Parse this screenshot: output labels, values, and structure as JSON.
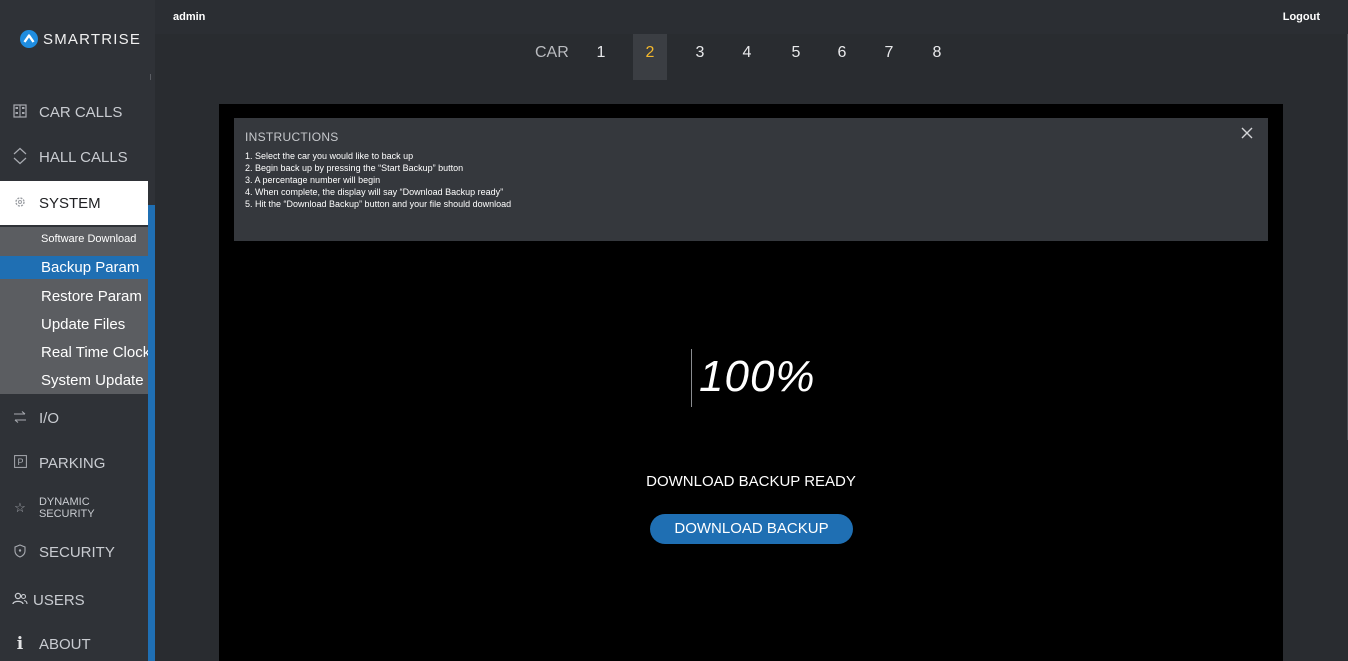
{
  "brand": {
    "name": "SMARTRISE",
    "logo_icon": "smartrise-chevron-logo",
    "accent_color": "#1f6fb3"
  },
  "topbar": {
    "user": "admin",
    "logout": "Logout"
  },
  "sidebar": {
    "items": [
      {
        "label": "CAR CALLS",
        "icon": "grid-icon"
      },
      {
        "label": "HALL CALLS",
        "icon": "up-down-chevrons-icon"
      },
      {
        "label": "SYSTEM",
        "icon": "gear-icon"
      },
      {
        "label": "I/O",
        "icon": "swap-arrows-icon"
      },
      {
        "label": "PARKING",
        "icon": "parking-icon"
      },
      {
        "label": "DYNAMIC SECURITY",
        "icon": "star-icon"
      },
      {
        "label": "SECURITY",
        "icon": "shield-icon"
      },
      {
        "label": "USERS",
        "icon": "users-icon"
      },
      {
        "label": "ABOUT",
        "icon": "info-icon"
      }
    ],
    "system_sub": [
      {
        "label": "Software Download"
      },
      {
        "label": "Backup Param"
      },
      {
        "label": "Restore Param"
      },
      {
        "label": "Update Files"
      },
      {
        "label": "Real Time Clock"
      },
      {
        "label": "System Update"
      }
    ],
    "active_sub": "Backup Param"
  },
  "car_selector": {
    "label": "CAR",
    "cars": [
      "1",
      "2",
      "3",
      "4",
      "5",
      "6",
      "7",
      "8"
    ],
    "selected": "2",
    "selected_color": "#f4b82c"
  },
  "instructions": {
    "title": "INSTRUCTIONS",
    "lines": [
      "1. Select the car you would like to back up",
      "2. Begin back up by pressing the “Start Backup” button",
      "3. A percentage number will begin",
      "4. When complete, the display will say “Download Backup ready”",
      "5. Hit the “Download Backup” button and your file should download"
    ]
  },
  "backup": {
    "progress_text": "100%",
    "progress": 100,
    "status": "DOWNLOAD BACKUP READY",
    "button_label": "DOWNLOAD BACKUP"
  }
}
